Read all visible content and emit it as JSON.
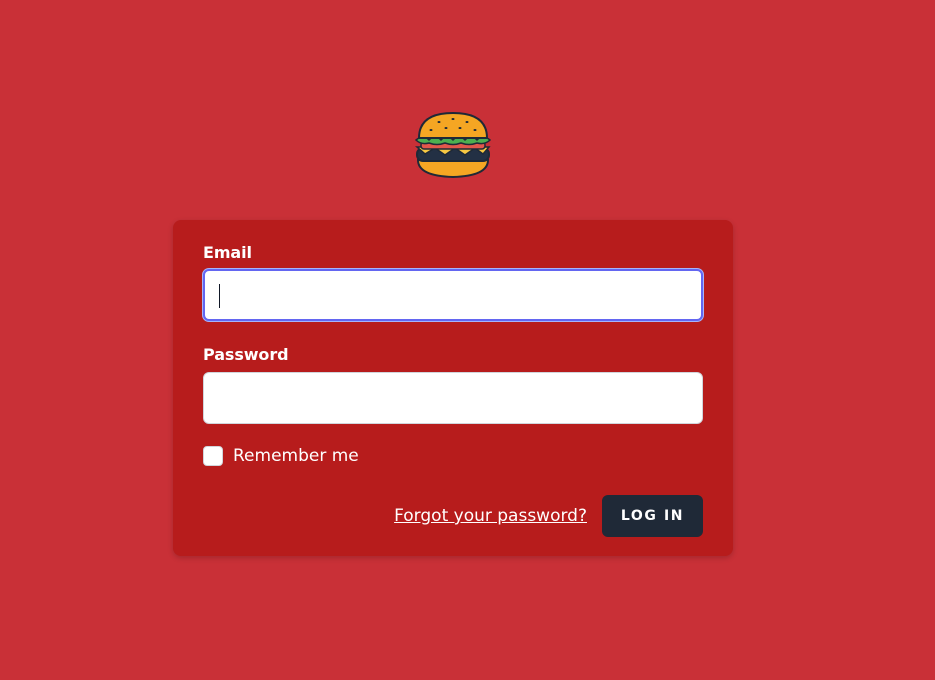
{
  "logo": {
    "icon": "burger-icon"
  },
  "form": {
    "email_label": "Email",
    "email_value": "",
    "password_label": "Password",
    "password_value": "",
    "remember_label": "Remember me",
    "remember_checked": false,
    "forgot_link": "Forgot your password?",
    "login_button": "LOG IN"
  },
  "colors": {
    "page_background": "#c93037",
    "card_background": "#b71c1c",
    "button_background": "#1f2937",
    "focus_ring": "#6366f1"
  }
}
